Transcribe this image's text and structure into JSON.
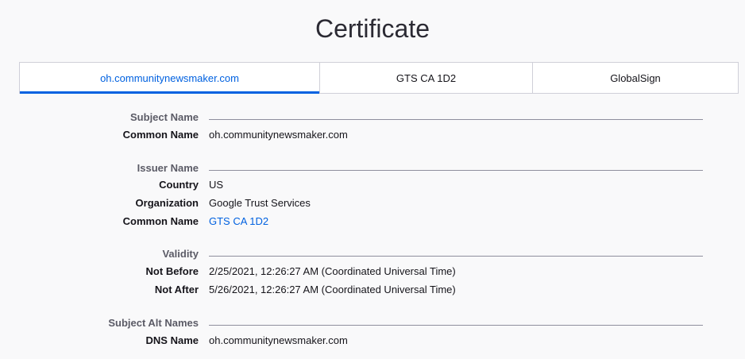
{
  "title": "Certificate",
  "tabs": [
    {
      "label": "oh.communitynewsmaker.com"
    },
    {
      "label": "GTS CA 1D2"
    },
    {
      "label": "GlobalSign"
    }
  ],
  "subject": {
    "heading": "Subject Name",
    "common_name_key": "Common Name",
    "common_name_val": "oh.communitynewsmaker.com"
  },
  "issuer": {
    "heading": "Issuer Name",
    "country_key": "Country",
    "country_val": "US",
    "organization_key": "Organization",
    "organization_val": "Google Trust Services",
    "common_name_key": "Common Name",
    "common_name_val": "GTS CA 1D2"
  },
  "validity": {
    "heading": "Validity",
    "not_before_key": "Not Before",
    "not_before_val": "2/25/2021, 12:26:27 AM (Coordinated Universal Time)",
    "not_after_key": "Not After",
    "not_after_val": "5/26/2021, 12:26:27 AM (Coordinated Universal Time)"
  },
  "san": {
    "heading": "Subject Alt Names",
    "dns_key": "DNS Name",
    "dns_val": "oh.communitynewsmaker.com"
  },
  "colors": {
    "accent": "#0061e0",
    "background": "#f9f9fa",
    "section_label": "#5b5b66"
  }
}
